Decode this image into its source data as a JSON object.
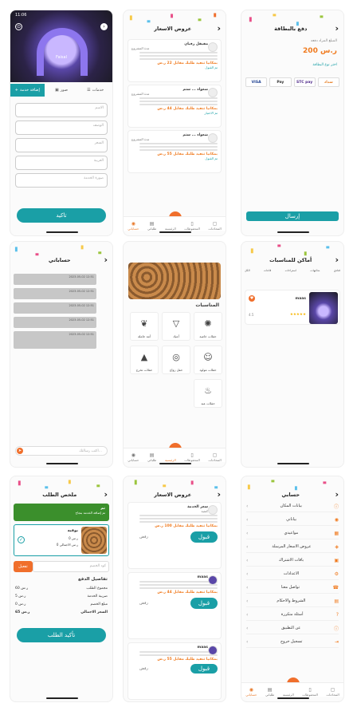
{
  "colors": {
    "teal": "#1a9fa6",
    "orange": "#f07a1e",
    "purple": "#8d76ee"
  },
  "s1": {
    "status_time": "11:06",
    "venue_name": "Faisal",
    "tabs": {
      "add_service": "إضافة خدمة",
      "photos": "صور",
      "services": "خدمات"
    },
    "fields": [
      "الاسم",
      "الوصف",
      "السعر",
      "العربية",
      "صورة الخدمة"
    ],
    "confirm_label": "تاكيد"
  },
  "s2": {
    "title": "عروض الاسعار",
    "cards": [
      {
        "name": "مفيقل رفيان",
        "meta": "مدة المشروع",
        "price": "بمكانيا تنفيذ طلبك مقابل 22 ر.س",
        "link": "تم القبول"
      },
      {
        "name": "شعواء ... ستم",
        "meta": "مدة المشروع",
        "price": "بمكانيا تنفيذ طلبك مقابل 44 ر.س",
        "link": "تم الاختيار"
      },
      {
        "name": "شعواء ... ستم",
        "meta": "مدة المشروع",
        "price": "بمكانيا تنفيذ طلبك مقابل 55 ر.س",
        "link": "تم القبول"
      }
    ],
    "tabs": [
      "حساباتي",
      "طلباتي",
      "الرئيسية",
      "المحفوظات",
      "المحادثات"
    ]
  },
  "s3": {
    "title": "دفع بالبطاقة",
    "amount_label": "المبلغ المراد دفعه",
    "amount": "200 ر.س",
    "choose_label": "اختر نوع البطاقة",
    "logos": [
      "VISA",
      "Pay",
      "STC pay",
      "سداد"
    ],
    "send_label": "إرسال"
  },
  "s4": {
    "title": "حساباتي",
    "rows": [
      "2023-05-02 12:51",
      "2023-05-02 12:51",
      "2023-05-02 12:51",
      "2023-05-02 12:51",
      "2023-05-02 12:51"
    ],
    "search_placeholder": "اكتب رسالتك..."
  },
  "s5": {
    "section": "المناسبات",
    "tiles": [
      "حفلات خاصة",
      "أعياد",
      "أمة حاملة",
      "حفلات مولود",
      "حفل زواج",
      "حفلات تخرج",
      "حفلات عيد"
    ],
    "tabs": [
      "حساباتي",
      "طلباتي",
      "الرئيسية",
      "المحفوظات",
      "المحادثات"
    ]
  },
  "s6": {
    "title": "أماكن للمناسبات",
    "categories": [
      "الكل",
      "قاعات",
      "استراحات",
      "شاليهات",
      "فنادق"
    ],
    "venue": {
      "name": "maas",
      "stars": "★★★★★",
      "rating": "4.5"
    }
  },
  "s7": {
    "title": "ملخص الطلب",
    "banner_title": "تم",
    "banner_sub": "تم إضافة الخدمة بنجاح",
    "item_name": "بوفيه",
    "item_price1": "0 ر.س",
    "item_price2": "0 ر.س الاجمالي",
    "coupon_placeholder": "كود الخصم",
    "activate_label": "تفعيل",
    "details_title": "تفاصيل الدفع",
    "details": [
      {
        "label": "مجموع الطلب",
        "value": "60 ر.س"
      },
      {
        "label": "ضريبة الخدمة",
        "value": "5 ر.س"
      },
      {
        "label": "مبلغ الخصم",
        "value": "0 ر.س"
      },
      {
        "label": "السعر الاجمالي",
        "value": "65 ر.س"
      }
    ],
    "confirm_label": "تأكيد الطلب"
  },
  "s8": {
    "title": "عروض الاسعار",
    "cards": [
      {
        "name": "سعر الخدمة",
        "sub": "كنفية",
        "price": "بمكانيا تنفيذ طلبك مقابل 100 ر.س"
      },
      {
        "name": "maas",
        "sub": "",
        "price": "بمكانيا تنفيذ طلبك مقابل 44 ر.س"
      },
      {
        "name": "maas",
        "sub": "",
        "price": "بمكانيا تنفيذ طلبك مقابل 55 ر.س"
      }
    ],
    "accept": "قبول",
    "reject": "رفض"
  },
  "s9": {
    "title": "حسابي",
    "rows": [
      "بيانات المكان",
      "بياناتي",
      "مواعيدي",
      "عروض الاسعار المرسلة",
      "باقات الاشتراك",
      "الاعدادات",
      "تواصل معنا",
      "الشروط والاحكام",
      "أسئلة متكررة",
      "عن التطبيق",
      "تسجيل خروج"
    ],
    "tabs": [
      "حساباتي",
      "طلباتي",
      "الرئيسية",
      "المحفوظات",
      "المحادثات"
    ]
  }
}
